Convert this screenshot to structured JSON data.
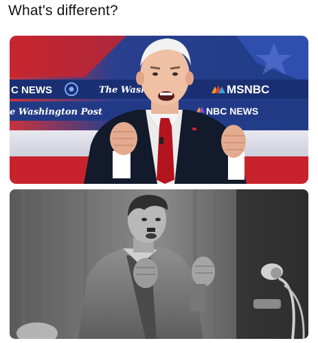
{
  "caption": "What's different?",
  "top_photo": {
    "banner_row1": [
      "C NEWS",
      "The Wash",
      "MSNBC"
    ],
    "banner_row2": [
      "e Washington Post",
      "NBC NEWS"
    ]
  },
  "colors": {
    "stage_blue": "#1f3c86",
    "stage_red": "#c8232d",
    "suit_navy": "#121a2c",
    "tie_red": "#b4141e",
    "bw_dark": "#2a2a2a",
    "bw_light": "#cfcfcf"
  }
}
